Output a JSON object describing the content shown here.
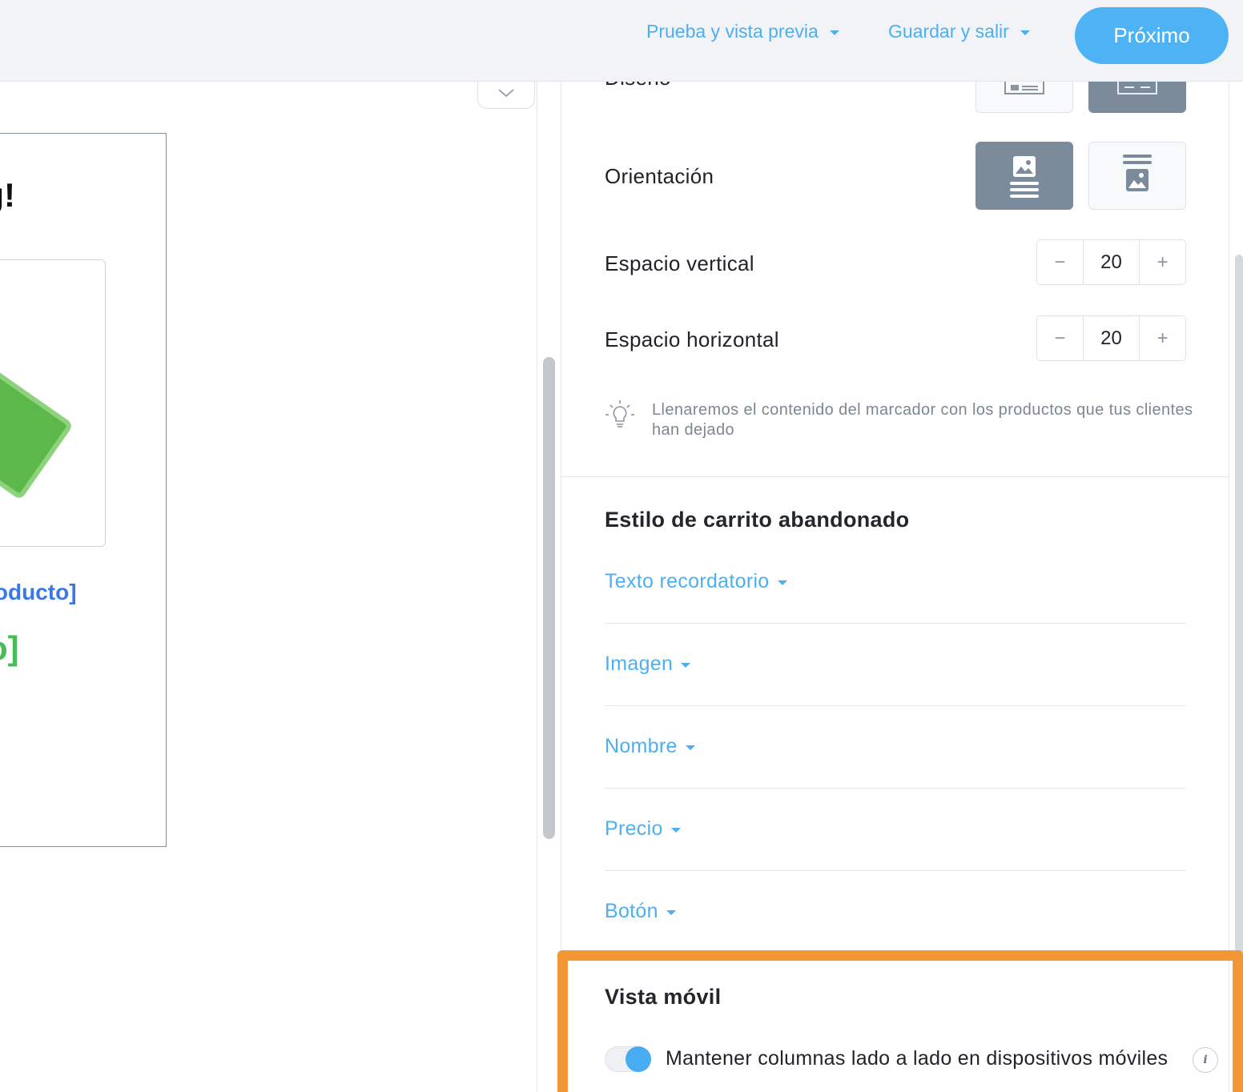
{
  "header": {
    "test_preview_label": "Prueba y vista previa",
    "save_exit_label": "Guardar y salir",
    "next_label": "Próximo"
  },
  "preview": {
    "heading_fragment": "ing!",
    "product_name_token": "roducto]",
    "product_price_token": "o]"
  },
  "settings": {
    "design_label": "Diseño",
    "orientation_label": "Orientación",
    "vertical_spacing_label": "Espacio vertical",
    "vertical_spacing_value": "20",
    "horizontal_spacing_label": "Espacio horizontal",
    "horizontal_spacing_value": "20",
    "stepper_minus": "−",
    "stepper_plus": "+",
    "hint": "Llenaremos el contenido del marcador con los productos que tus clientes han dejado"
  },
  "cart_style": {
    "title": "Estilo de carrito abandonado",
    "items": [
      "Texto recordatorio",
      "Imagen",
      "Nombre",
      "Precio",
      "Botón"
    ]
  },
  "mobile": {
    "title": "Vista móvil",
    "toggle_label": "Mantener columnas lado a lado en dispositivos móviles",
    "toggle_on": true,
    "info_glyph": "i"
  },
  "colors": {
    "accent": "#4cb0f0",
    "highlight": "#f39636",
    "active_layout": "#7c8b9b"
  }
}
